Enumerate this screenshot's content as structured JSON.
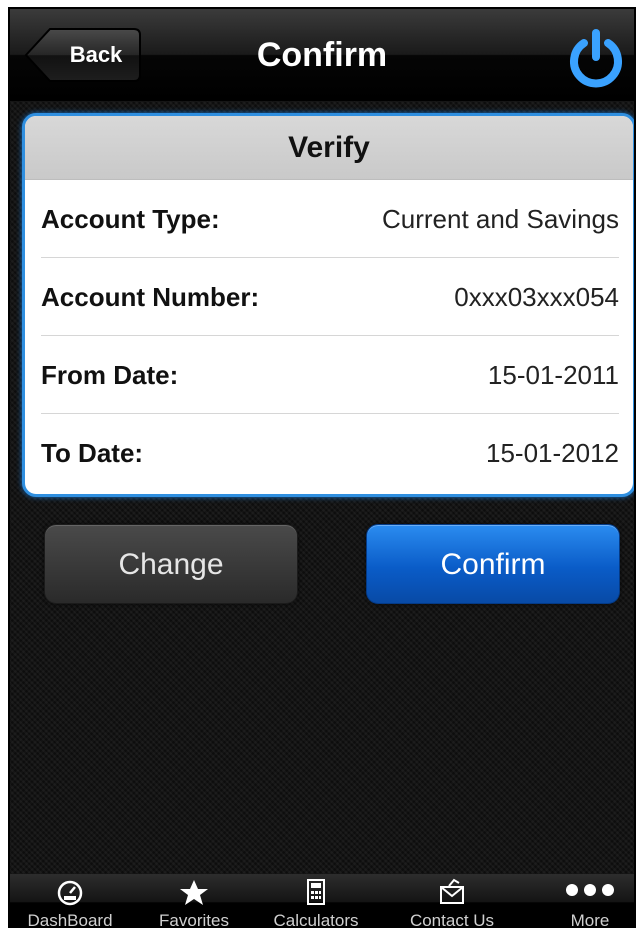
{
  "nav": {
    "back_label": "Back",
    "title": "Confirm",
    "power_icon": "power-icon"
  },
  "card": {
    "title": "Verify",
    "rows": [
      {
        "label": "Account Type:",
        "value": "Current and Savings"
      },
      {
        "label": "Account Number:",
        "value": "0xxx03xxx054"
      },
      {
        "label": "From Date:",
        "value": "15-01-2011"
      },
      {
        "label": "To Date:",
        "value": "15-01-2012"
      }
    ]
  },
  "buttons": {
    "change_label": "Change",
    "confirm_label": "Confirm"
  },
  "tabs": [
    {
      "label": "DashBoard",
      "icon": "gauge-icon"
    },
    {
      "label": "Favorites",
      "icon": "star-icon"
    },
    {
      "label": "Calculators",
      "icon": "calculator-icon"
    },
    {
      "label": "Contact Us",
      "icon": "envelope-icon"
    },
    {
      "label": "More",
      "icon": "more-dots-icon"
    }
  ],
  "colors": {
    "accent_blue": "#2f8fe0",
    "confirm_button": "#0a5cc8",
    "background": "#141414"
  }
}
